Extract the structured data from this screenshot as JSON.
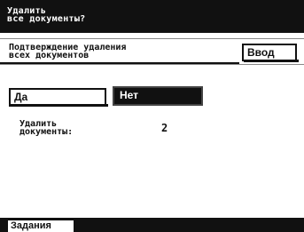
{
  "title": {
    "line1": "Удалить",
    "line2": "все документы?"
  },
  "header": {
    "line1": "Подтверждение удаления",
    "line2": "всех документов",
    "ok_label": "Ввод"
  },
  "choices": {
    "yes_label": "Да",
    "no_label": "Нет",
    "selected": "no"
  },
  "delete_info": {
    "label_line1": "Удалить",
    "label_line2": "документы:",
    "count": "2"
  },
  "tabs": {
    "jobs_label": "Задания"
  },
  "colors": {
    "dark": "#111111",
    "light": "#ffffff"
  }
}
